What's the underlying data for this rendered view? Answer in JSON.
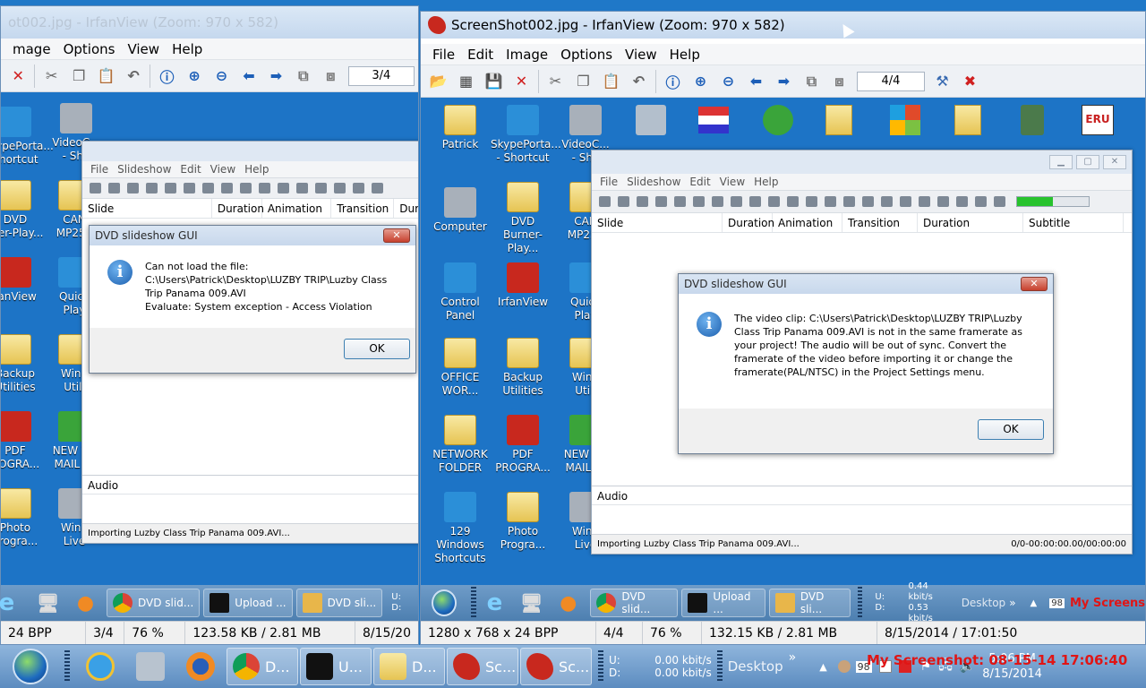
{
  "left_window": {
    "title": "ot002.jpg - IrfanView (Zoom: 970 x 582)",
    "menu": [
      "mage",
      "Options",
      "View",
      "Help"
    ],
    "page_indicator": "3/4",
    "desktop_icons": [
      {
        "label": "SkypePorta...\nShortcut"
      },
      {
        "label": "VideoC...\n- Sho"
      },
      {
        "label": "DVD\nrner-Play..."
      },
      {
        "label": "CAN\nMP250"
      },
      {
        "label": "fanView"
      },
      {
        "label": "Quick\nPlay"
      },
      {
        "label": "Backup\nUtilities"
      },
      {
        "label": "Wind\nUtili"
      },
      {
        "label": "PDF\nROGRA..."
      },
      {
        "label": "NEW Y...\nMAIL IN"
      },
      {
        "label": "Photo\nProgra..."
      },
      {
        "label": "Wind\nLive"
      }
    ],
    "dvd_menu": [
      "File",
      "Slideshow",
      "Edit",
      "View",
      "Help"
    ],
    "grid_columns": [
      "Slide",
      "Duration",
      "Animation",
      "Transition",
      "Dur"
    ],
    "audio_label": "Audio",
    "status_text": "Importing Luzby Class Trip Panama 009.AVI...",
    "dialog": {
      "title": "DVD slideshow GUI",
      "message": "Can not load the file: C:\\Users\\Patrick\\Desktop\\LUZBY TRIP\\Luzby Class Trip Panama 009.AVI\nEvaluate: System exception - Access Violation",
      "ok": "OK",
      "close": "✕"
    },
    "taskbar_buttons": [
      "DVD slid...",
      "Upload ...",
      "DVD sli..."
    ],
    "speed": "U:\nD:",
    "statusbar": [
      "24 BPP",
      "3/4",
      "76 %",
      "123.58 KB / 2.81 MB",
      "8/15/20"
    ]
  },
  "right_window": {
    "title": "ScreenShot002.jpg - IrfanView (Zoom: 970 x 582)",
    "menu": [
      "File",
      "Edit",
      "Image",
      "Options",
      "View",
      "Help"
    ],
    "page_indicator": "4/4",
    "desktop_icons": [
      {
        "label": "Patrick"
      },
      {
        "label": "SkypePorta...\n- Shortcut"
      },
      {
        "label": "VideoC...\n- Sho"
      },
      {
        "label": "Computer"
      },
      {
        "label": "DVD\nBurner-Play..."
      },
      {
        "label": "CAN\nMP250"
      },
      {
        "label": "Control Panel"
      },
      {
        "label": "IrfanView"
      },
      {
        "label": "Quick\nPlay"
      },
      {
        "label": "OFFICE\nWOR..."
      },
      {
        "label": "Backup\nUtilities"
      },
      {
        "label": "Wind\nUtili"
      },
      {
        "label": "NETWORK\nFOLDER"
      },
      {
        "label": "PDF\nPROGRA..."
      },
      {
        "label": "NEW Y...\nMAIL IN"
      },
      {
        "label": "129 Windows\nShortcuts"
      },
      {
        "label": "Photo\nProgra..."
      },
      {
        "label": "Wind\nLive"
      }
    ],
    "dvd_menu": [
      "File",
      "Slideshow",
      "Edit",
      "View",
      "Help"
    ],
    "grid_columns": [
      "Slide",
      "Duration",
      "Animation",
      "Transition",
      "Duration",
      "Subtitle"
    ],
    "progress_fraction": 0.5,
    "audio_label": "Audio",
    "status_text": "Importing Luzby Class Trip Panama 009.AVI...",
    "status_right": "0/0-00:00:00.00/00:00:00",
    "dialog": {
      "title": "DVD slideshow GUI",
      "message": "The video clip: C:\\Users\\Patrick\\Desktop\\LUZBY TRIP\\Luzby Class Trip Panama 009.AVI is not in the same framerate as your project! The audio will be out of sync. Convert the framerate of the video before importing it or change the framerate(PAL/NTSC) in the Project Settings menu.",
      "ok": "OK",
      "close": "✕"
    },
    "taskbar_buttons": [
      "DVD slid...",
      "Upload ...",
      "DVD sli..."
    ],
    "speed": "U:\nD:",
    "speed_values": "0.44 kbit/s\n0.53 kbit/s",
    "desktop_label": "Desktop",
    "chevron": "»",
    "clock_fragment": "98",
    "watermark": "My Screens",
    "statusbar": [
      "1280 x 768 x 24 BPP",
      "4/4",
      "76 %",
      "132.15 KB / 2.81 MB",
      "8/15/2014 / 17:01:50"
    ]
  },
  "taskbar": {
    "apps": [
      {
        "label": "D..."
      },
      {
        "label": "U..."
      },
      {
        "label": "D..."
      },
      {
        "label": "Sc..."
      },
      {
        "label": "Sc..."
      }
    ],
    "speed_labels": "U:\nD:",
    "speed_values": "0.00 kbit/s\n0.00 kbit/s",
    "desktop_label": "Desktop",
    "chevron": "»",
    "tray_number": "98",
    "watermark": "My Screenshot: 08-15-14 17:06:40",
    "time": "5:06 PM",
    "date": "8/15/2014"
  },
  "colors": {
    "desktop_blue": "#1d74c6",
    "watermark_red": "#e01515",
    "progress_green": "#27c22d"
  }
}
